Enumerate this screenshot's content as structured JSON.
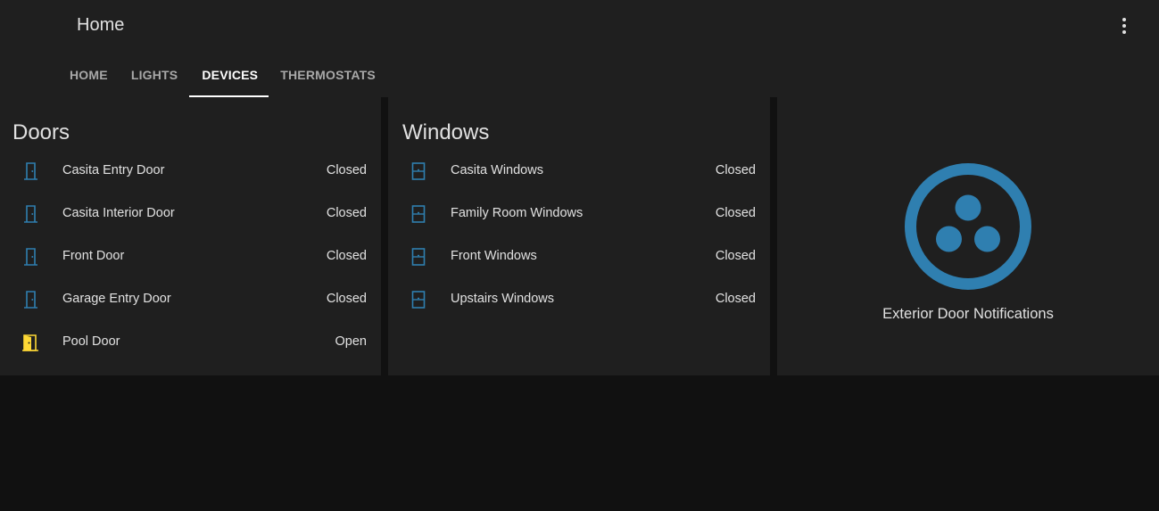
{
  "header": {
    "title": "Home",
    "menu_icon": "dots-vertical-icon"
  },
  "tabs": [
    {
      "label": "HOME",
      "active": false
    },
    {
      "label": "LIGHTS",
      "active": false
    },
    {
      "label": "DEVICES",
      "active": true
    },
    {
      "label": "THERMOSTATS",
      "active": false
    }
  ],
  "doors": {
    "title": "Doors",
    "items": [
      {
        "name": "Casita Entry Door",
        "state": "Closed",
        "icon": "door-closed-icon"
      },
      {
        "name": "Casita Interior Door",
        "state": "Closed",
        "icon": "door-closed-icon"
      },
      {
        "name": "Front Door",
        "state": "Closed",
        "icon": "door-closed-icon"
      },
      {
        "name": "Garage Entry Door",
        "state": "Closed",
        "icon": "door-closed-icon"
      },
      {
        "name": "Pool Door",
        "state": "Open",
        "icon": "door-open-icon"
      }
    ]
  },
  "windows": {
    "title": "Windows",
    "items": [
      {
        "name": "Casita Windows",
        "state": "Closed",
        "icon": "window-closed-icon"
      },
      {
        "name": "Family Room Windows",
        "state": "Closed",
        "icon": "window-closed-icon"
      },
      {
        "name": "Front Windows",
        "state": "Closed",
        "icon": "window-closed-icon"
      },
      {
        "name": "Upstairs Windows",
        "state": "Closed",
        "icon": "window-closed-icon"
      }
    ]
  },
  "notifications": {
    "label": "Exterior Door Notifications",
    "icon": "automation-circle-icon"
  },
  "colors": {
    "accent_blue": "#2f7fb0",
    "active_yellow": "#fdd835",
    "card_bg": "#1f1f1f",
    "page_bg": "#111111"
  }
}
